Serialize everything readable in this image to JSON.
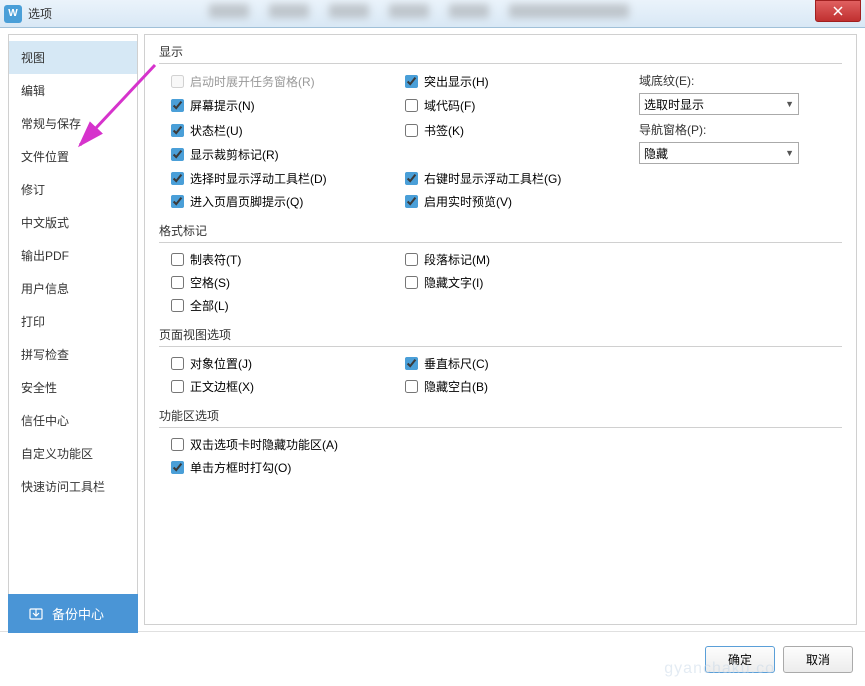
{
  "titlebar": {
    "icon_letter": "W",
    "title": "选项"
  },
  "sidebar": {
    "items": [
      {
        "label": "视图",
        "active": true
      },
      {
        "label": "编辑",
        "active": false
      },
      {
        "label": "常规与保存",
        "active": false
      },
      {
        "label": "文件位置",
        "active": false
      },
      {
        "label": "修订",
        "active": false
      },
      {
        "label": "中文版式",
        "active": false
      },
      {
        "label": "输出PDF",
        "active": false
      },
      {
        "label": "用户信息",
        "active": false
      },
      {
        "label": "打印",
        "active": false
      },
      {
        "label": "拼写检查",
        "active": false
      },
      {
        "label": "安全性",
        "active": false
      },
      {
        "label": "信任中心",
        "active": false
      },
      {
        "label": "自定义功能区",
        "active": false
      },
      {
        "label": "快速访问工具栏",
        "active": false
      }
    ]
  },
  "sections": {
    "display": {
      "title": "显示",
      "items": {
        "startup_taskpane": {
          "label": "启动时展开任务窗格(R)",
          "checked": false,
          "disabled": true
        },
        "highlight": {
          "label": "突出显示(H)",
          "checked": true
        },
        "screen_tips": {
          "label": "屏幕提示(N)",
          "checked": true
        },
        "field_codes": {
          "label": "域代码(F)",
          "checked": false
        },
        "status_bar": {
          "label": "状态栏(U)",
          "checked": true
        },
        "bookmarks": {
          "label": "书签(K)",
          "checked": false
        },
        "crop_marks": {
          "label": "显示裁剪标记(R)",
          "checked": true
        },
        "floating_toolbar_select": {
          "label": "选择时显示浮动工具栏(D)",
          "checked": true
        },
        "floating_toolbar_right": {
          "label": "右键时显示浮动工具栏(G)",
          "checked": true
        },
        "header_footer_tip": {
          "label": "进入页眉页脚提示(Q)",
          "checked": true
        },
        "realtime_preview": {
          "label": "启用实时预览(V)",
          "checked": true
        }
      },
      "dropdowns": {
        "field_shading": {
          "label": "域底纹(E):",
          "value": "选取时显示"
        },
        "nav_pane": {
          "label": "导航窗格(P):",
          "value": "隐藏"
        }
      }
    },
    "format_marks": {
      "title": "格式标记",
      "items": {
        "tabs": {
          "label": "制表符(T)",
          "checked": false
        },
        "paragraph_marks": {
          "label": "段落标记(M)",
          "checked": false
        },
        "spaces": {
          "label": "空格(S)",
          "checked": false
        },
        "hidden_text": {
          "label": "隐藏文字(I)",
          "checked": false
        },
        "all": {
          "label": "全部(L)",
          "checked": false
        }
      }
    },
    "page_view": {
      "title": "页面视图选项",
      "items": {
        "object_position": {
          "label": "对象位置(J)",
          "checked": false
        },
        "vertical_ruler": {
          "label": "垂直标尺(C)",
          "checked": true
        },
        "text_boundaries": {
          "label": "正文边框(X)",
          "checked": false
        },
        "hide_whitespace": {
          "label": "隐藏空白(B)",
          "checked": false
        }
      }
    },
    "ribbon": {
      "title": "功能区选项",
      "items": {
        "dbl_click_hide": {
          "label": "双击选项卡时隐藏功能区(A)",
          "checked": false
        },
        "single_click_check": {
          "label": "单击方框时打勾(O)",
          "checked": true
        }
      }
    }
  },
  "footer": {
    "backup": "备份中心",
    "ok": "确定",
    "cancel": "取消"
  },
  "watermark": "gyanchaku.co"
}
